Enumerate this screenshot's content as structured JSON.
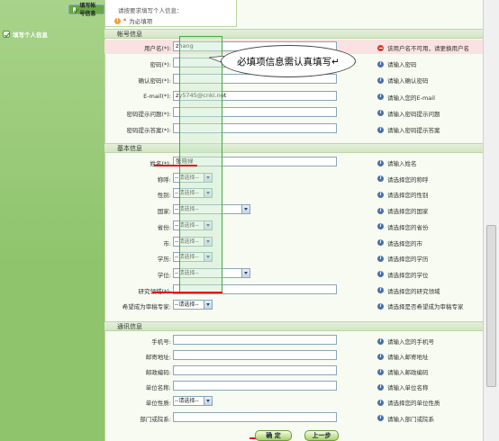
{
  "sidebar": {
    "items": [
      {
        "label": "填写帐号信息"
      },
      {
        "label": "填写个人信息"
      }
    ]
  },
  "header": {
    "tab_title": "请按要求填写个人信息：",
    "required_note": "为必填项",
    "required_star": "*"
  },
  "annotation": {
    "text": "必填项信息需认真填写↵"
  },
  "account": {
    "title": "帐号信息",
    "fields": [
      {
        "label": "用户名(*):",
        "value": "zhang",
        "hint": "该用户名不可用，请更换用户名",
        "error": true
      },
      {
        "label": "密码(*):",
        "value": "",
        "hint": "请输入密码"
      },
      {
        "label": "确认密码(*):",
        "value": "",
        "hint": "请输入确认密码"
      },
      {
        "label": "E-mail(*):",
        "value": "zy5745@cnki.net",
        "hint": "请输入您的E-mail"
      },
      {
        "label": "密码提示问题(*):",
        "value": "",
        "hint": "请输入密码提示问题"
      },
      {
        "label": "密码提示答案(*):",
        "value": "",
        "hint": "请输入密码提示答案"
      }
    ]
  },
  "basic": {
    "title": "基本信息",
    "fields": [
      {
        "label": "姓名(*):",
        "value": "张晓禄",
        "hint": "请输入姓名",
        "kind": "input"
      },
      {
        "label": "称呼:",
        "value": "--请选择--",
        "hint": "请选择您的称呼",
        "kind": "select",
        "w": "s"
      },
      {
        "label": "性别:",
        "value": "--请选择--",
        "hint": "请选择您的性别",
        "kind": "select",
        "w": "s"
      },
      {
        "label": "国家:",
        "value": "--请选择--",
        "hint": "请选择您的国家",
        "kind": "select",
        "w": "l"
      },
      {
        "label": "省份:",
        "value": "--请选择--",
        "hint": "请选择您的省份",
        "kind": "select",
        "w": "s"
      },
      {
        "label": "市:",
        "value": "--请选择--",
        "hint": "请选择您的市",
        "kind": "select",
        "w": "s"
      },
      {
        "label": "学历:",
        "value": "--请选择--",
        "hint": "请选择您的学历",
        "kind": "select",
        "w": "s"
      },
      {
        "label": "学位:",
        "value": "--请选择--",
        "hint": "请选择您的学位",
        "kind": "select",
        "w": "l"
      },
      {
        "label": "研究领域(*):",
        "value": "",
        "hint": "请选择您的研究领域",
        "kind": "input"
      },
      {
        "label": "希望成为审稿专家:",
        "value": "--请选择--",
        "hint": "请选择是否希望成为审稿专家",
        "kind": "select",
        "w": "s"
      }
    ]
  },
  "contact": {
    "title": "通讯信息",
    "fields": [
      {
        "label": "手机号:",
        "value": "",
        "hint": "请输入您的手机号",
        "kind": "input"
      },
      {
        "label": "邮寄地址:",
        "value": "",
        "hint": "请输入邮寄地址",
        "kind": "input"
      },
      {
        "label": "邮政编码:",
        "value": "",
        "hint": "请输入邮政编码",
        "kind": "input"
      },
      {
        "label": "单位名称:",
        "value": "",
        "hint": "请输入单位名称",
        "kind": "input"
      },
      {
        "label": "单位性质:",
        "value": "--请选择--",
        "hint": "请选择您的单位性质",
        "kind": "select",
        "w": "s"
      },
      {
        "label": "部门或院系:",
        "value": "",
        "hint": "请输入部门或院系",
        "kind": "input"
      }
    ]
  },
  "buttons": {
    "confirm": "确 定",
    "prev": "上一步"
  },
  "colors": {
    "accent_green": "#8fc46c",
    "error_red": "#e03a2c",
    "info_blue": "#4b6fa8",
    "annotation_red": "#e31212"
  }
}
